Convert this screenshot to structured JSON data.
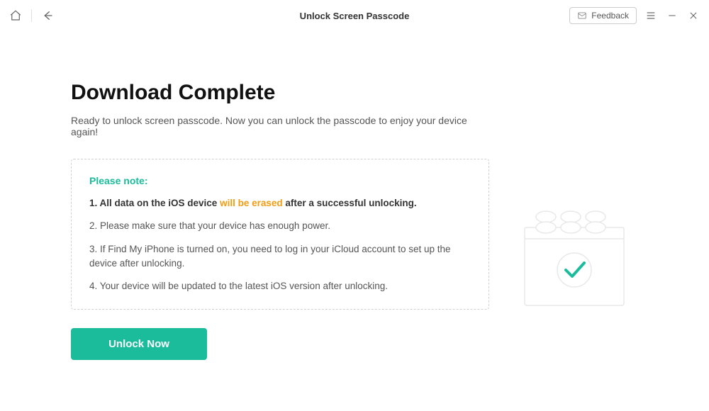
{
  "header": {
    "title": "Unlock Screen Passcode",
    "feedback_label": "Feedback"
  },
  "page": {
    "title": "Download Complete",
    "subtitle": "Ready to unlock screen passcode. Now you can unlock the passcode to enjoy your device again!"
  },
  "note": {
    "heading": "Please note:",
    "item1_prefix": "1. All data on the iOS device ",
    "item1_warn": "will be erased",
    "item1_suffix": " after a successful unlocking.",
    "item2": "2. Please make sure that your device has enough power.",
    "item3": "3. If Find My iPhone is turned on, you need to log in your iCloud account to set up the device after unlocking.",
    "item4": "4. Your device will be updated to the latest iOS version after unlocking."
  },
  "actions": {
    "unlock_label": "Unlock Now"
  },
  "colors": {
    "accent": "#1abc9c",
    "warn": "#f39c12"
  }
}
